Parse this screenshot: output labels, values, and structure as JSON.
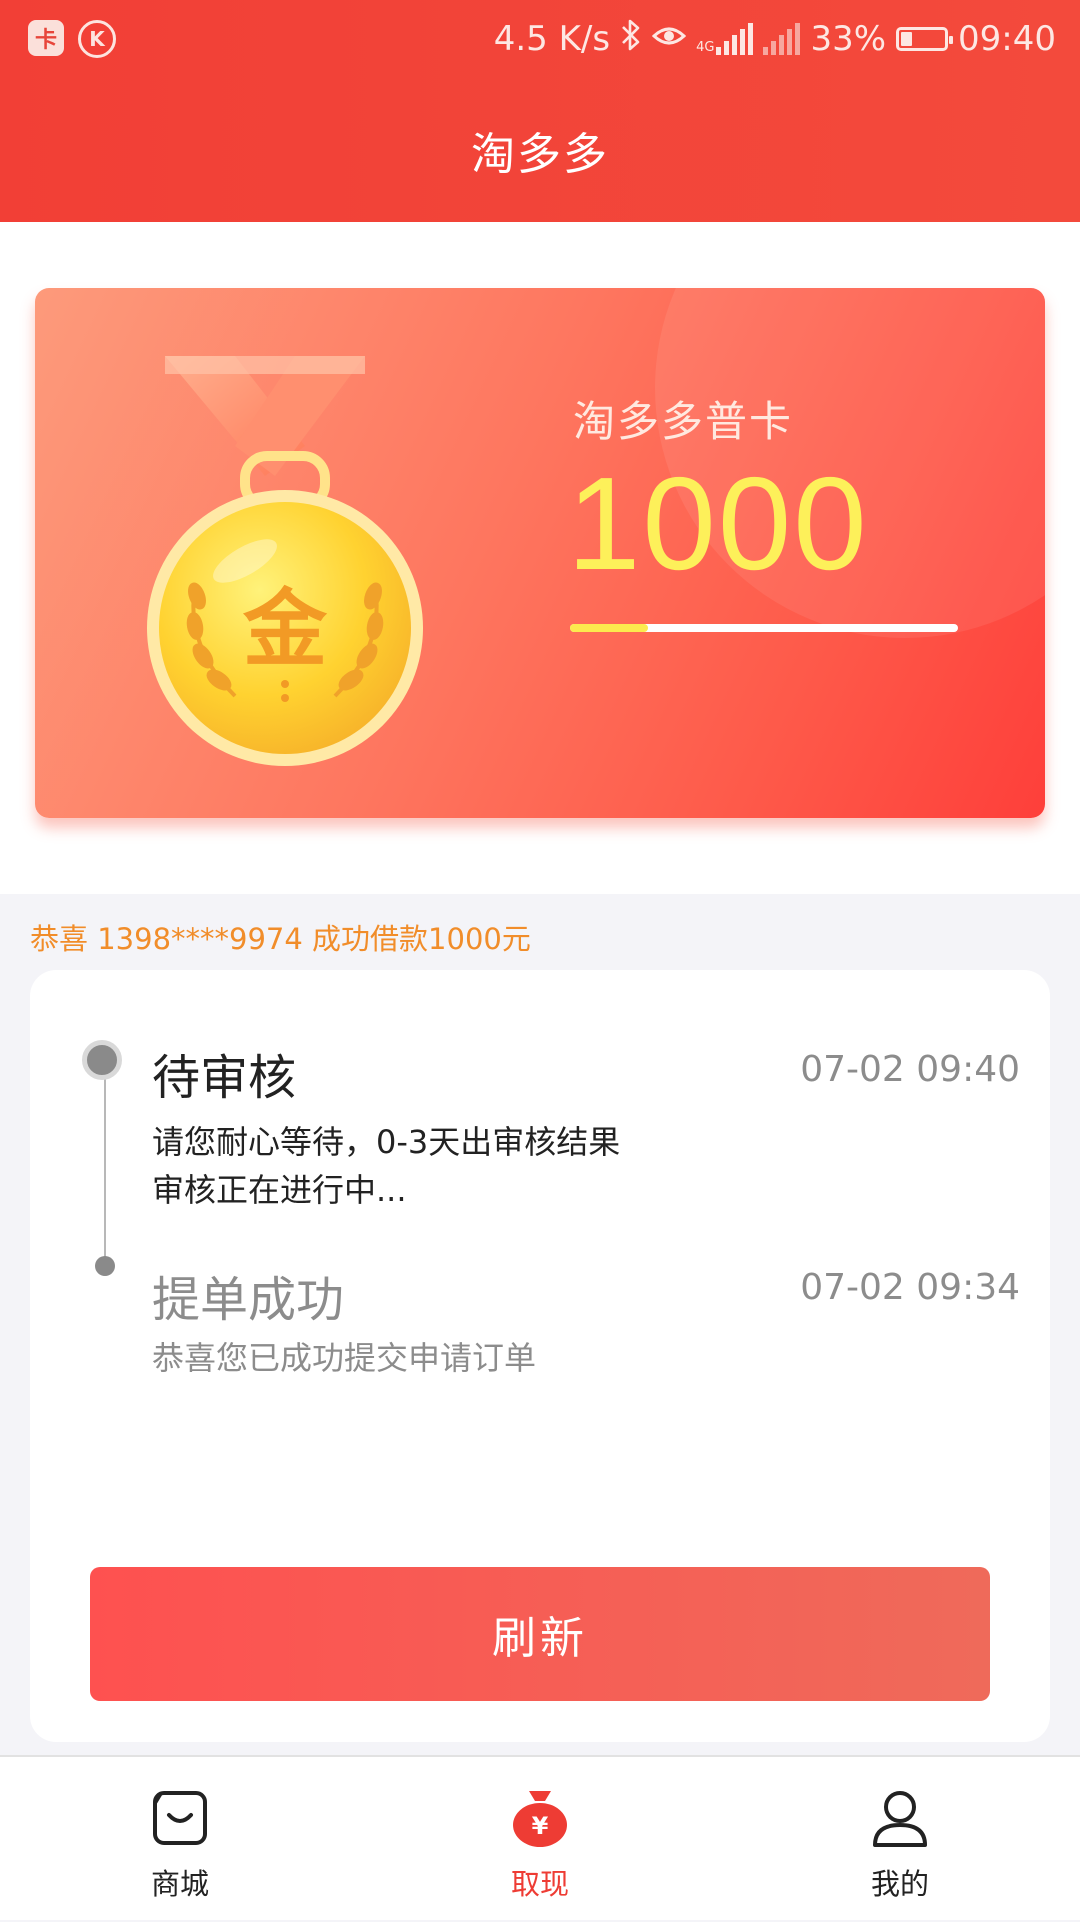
{
  "status_bar": {
    "app_icon_1": "app-badge-icon",
    "app_icon_2": "k-circle-icon",
    "network_speed": "4.5 K/s",
    "network_label": "4G",
    "battery": "33%",
    "battery_level": 0.33,
    "time": "09:40"
  },
  "header": {
    "title": "淘多多"
  },
  "card": {
    "name": "淘多多普卡",
    "amount": "1000",
    "progress": 0.2,
    "medal_text": "金",
    "colors": {
      "amount": "#fdf05a",
      "progress_fill": "#fcea4e"
    }
  },
  "notice": {
    "text": "恭喜 1398****9974 成功借款1000元",
    "color": "#f18d2a"
  },
  "timeline": {
    "steps": [
      {
        "title": "待审核",
        "time": "07-02  09:40",
        "desc_line1": "请您耐心等待，0-3天出审核结果",
        "desc_line2": "审核正在进行中..."
      },
      {
        "title": "提单成功",
        "time": "07-02 09:34",
        "desc_line1": "恭喜您已成功提交申请订单"
      }
    ]
  },
  "refresh_button": {
    "label": "刷新"
  },
  "tabbar": {
    "items": [
      {
        "label": "商城",
        "icon": "shopping-bag-icon",
        "active": false
      },
      {
        "label": "取现",
        "icon": "money-bag-icon",
        "active": true
      },
      {
        "label": "我的",
        "icon": "person-icon",
        "active": false
      }
    ],
    "active_color": "#ee3c34"
  }
}
